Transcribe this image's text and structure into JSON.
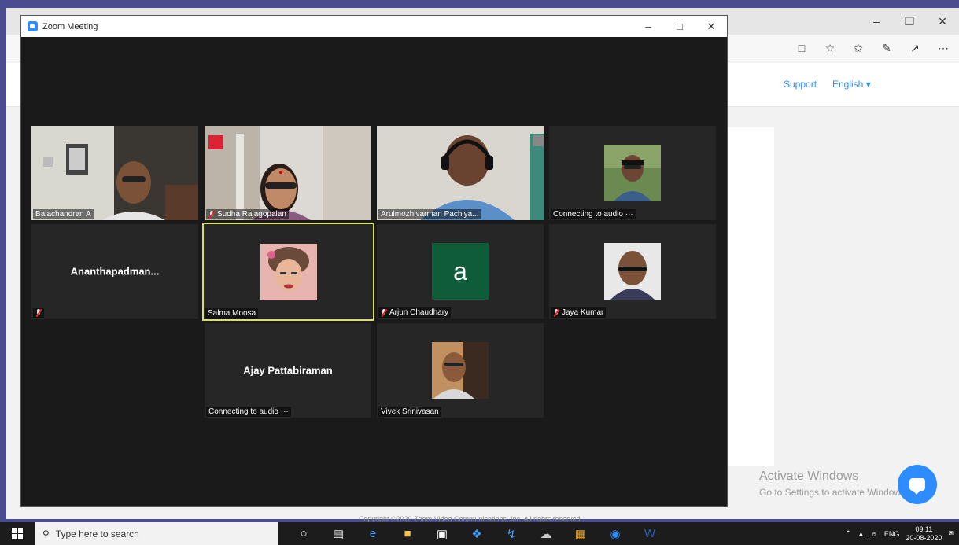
{
  "browser": {
    "header_links": {
      "support": "Support",
      "english": "English ▾"
    },
    "activate_windows": {
      "title": "Activate Windows",
      "subtitle": "Go to Settings to activate Windows."
    },
    "copyright": "Copyright ©2020 Zoom Video Communications, Inc. All rights reserved."
  },
  "zoom": {
    "title": "Zoom Meeting",
    "participants": [
      {
        "name": "Balachandran A",
        "type": "video",
        "muted": false
      },
      {
        "name": "Sudha Rajagopalan",
        "type": "video",
        "muted": true
      },
      {
        "name": "Arulmozhivarman Pachiya...",
        "type": "video",
        "muted": false
      },
      {
        "name": "Connecting to audio ···",
        "type": "photo",
        "muted": false
      },
      {
        "name": "Ananthapadman...",
        "label": "",
        "type": "name-only",
        "muted": true
      },
      {
        "name": "Salma Moosa",
        "type": "photo",
        "muted": false,
        "active": true
      },
      {
        "name": "Arjun Chaudhary",
        "type": "letter",
        "letter": "a",
        "muted": true
      },
      {
        "name": "Jaya Kumar",
        "type": "photo",
        "muted": true
      },
      {
        "name": "Ajay Pattabiraman",
        "status": "Connecting to audio ···",
        "type": "name-only",
        "muted": false
      },
      {
        "name": "Vivek Srinivasan",
        "type": "photo",
        "muted": false
      }
    ]
  },
  "taskbar": {
    "search_placeholder": "Type here to search",
    "tray_lang": "ENG",
    "time": "09:11",
    "date": "20-08-2020"
  }
}
